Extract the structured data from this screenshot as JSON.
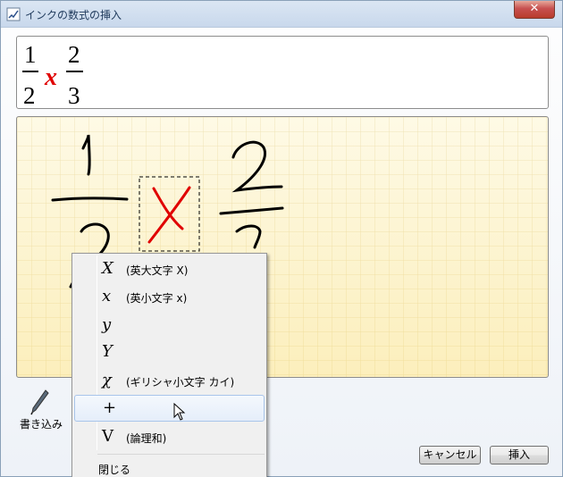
{
  "window": {
    "title": "インクの数式の挿入",
    "close_label": "✕"
  },
  "preview": {
    "numerator1": "1",
    "denominator1": "2",
    "variable": "x",
    "numerator2": "2",
    "denominator2": "3",
    "variable_color": "#e00000"
  },
  "toolbar": {
    "write_label": "書き込み",
    "cancel_label": "キャンセル",
    "insert_label": "挿入"
  },
  "context_menu": {
    "items": [
      {
        "symbol": "X",
        "description": "(英大文字 X)"
      },
      {
        "symbol": "x",
        "description": "(英小文字 x)"
      },
      {
        "symbol": "y",
        "description": ""
      },
      {
        "symbol": "Y",
        "description": ""
      },
      {
        "symbol": "χ",
        "description": "(ギリシャ小文字 カイ)"
      },
      {
        "symbol": "+",
        "description": ""
      },
      {
        "symbol": "V",
        "description": "(論理和)"
      }
    ],
    "close_label": "閉じる"
  },
  "colors": {
    "ink": "#000000",
    "selected_ink": "#e00000",
    "canvas_bg": "#fdf7d8"
  }
}
